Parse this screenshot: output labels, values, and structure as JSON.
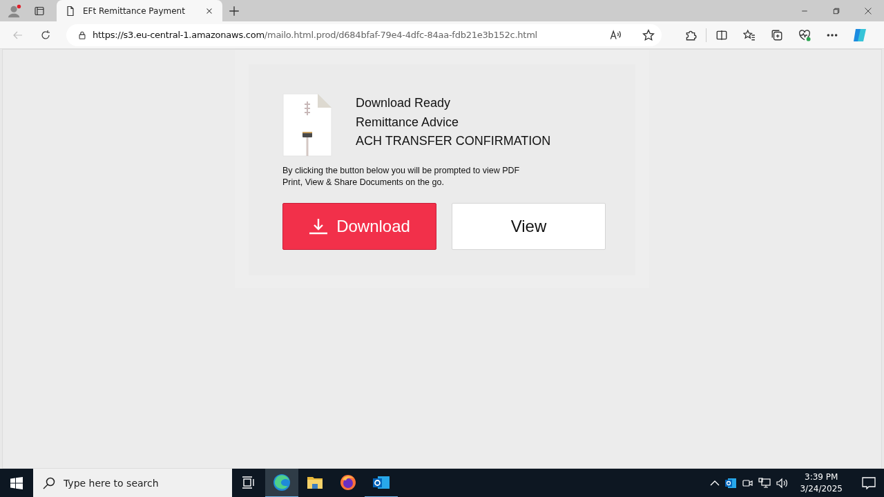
{
  "browser": {
    "tabs": [
      {
        "title": "EFt Remittance Payment",
        "selected": true
      }
    ],
    "url": {
      "host": "https://s3.eu-central-1.amazonaws.com",
      "path": "/mailo.html.prod/d684bfaf-79e4-4dfc-84aa-fdb21e3b152c.html"
    }
  },
  "page": {
    "headings": [
      "Download Ready",
      "Remittance Advice",
      "ACH TRANSFER CONFIRMATION"
    ],
    "notice": [
      "By clicking the button below you will be prompted to view PDF",
      "Print, View & Share Documents on the go."
    ],
    "buttons": [
      {
        "label": "Download",
        "kind": "primary"
      },
      {
        "label": "View",
        "kind": "secondary"
      }
    ]
  },
  "taskbar": {
    "search": {
      "placeholder": "Type here to search"
    },
    "apps": [
      {
        "kind": "edge",
        "selected": true,
        "running": true
      },
      {
        "kind": "folder",
        "selected": false,
        "running": false
      },
      {
        "kind": "firefox",
        "selected": false,
        "running": false
      },
      {
        "kind": "outlook",
        "selected": false,
        "running": true
      }
    ],
    "time": "3:39 PM",
    "date": "3/24/2025"
  }
}
